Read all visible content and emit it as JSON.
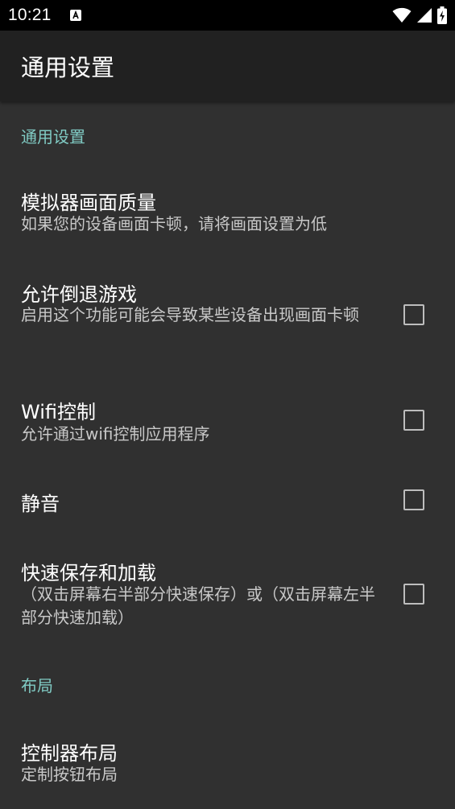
{
  "status_bar": {
    "time": "10:21",
    "icons": [
      "notification-a-icon",
      "wifi-icon",
      "signal-icon",
      "battery-charging-icon"
    ]
  },
  "app_bar": {
    "title": "通用设置"
  },
  "sections": {
    "general": {
      "header": "通用设置",
      "items": [
        {
          "title": "模拟器画面质量",
          "summary": "如果您的设备画面卡顿，请将画面设置为低"
        },
        {
          "title": "允许倒退游戏",
          "summary": "启用这个功能可能会导致某些设备出现画面卡顿",
          "checked": false
        },
        {
          "title": "Wifi控制",
          "summary": "允许通过wifi控制应用程序",
          "checked": false
        },
        {
          "title": "静音",
          "checked": false
        },
        {
          "title": "快速保存和加载",
          "summary": "（双击屏幕右半部分快速保存）或（双击屏幕左半部分快速加载）",
          "checked": false
        }
      ]
    },
    "layout": {
      "header": "布局",
      "items": [
        {
          "title": "控制器布局",
          "summary": "定制按钮布局"
        }
      ]
    }
  },
  "colors": {
    "background": "#303030",
    "app_bar": "#212121",
    "status_bar": "#000000",
    "accent": "#80cbc4",
    "summary_text": "#c8c8c8",
    "checkbox_border": "#bdbdbd"
  }
}
